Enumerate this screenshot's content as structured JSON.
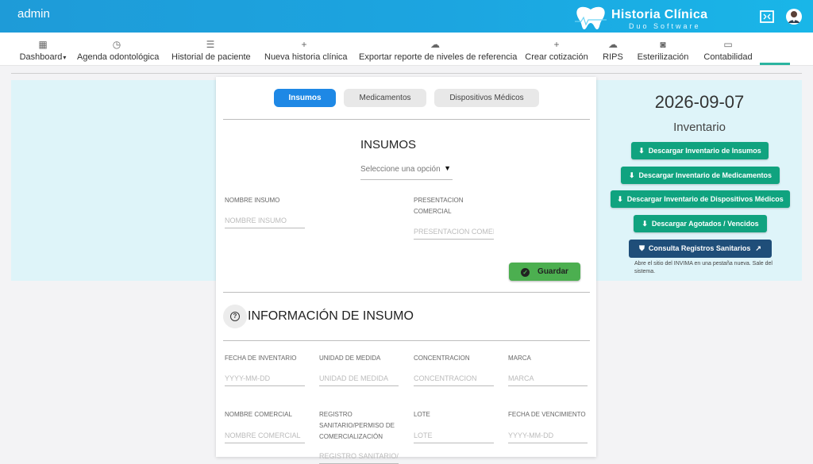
{
  "header": {
    "user": "admin",
    "logo_title": "Historia Clínica",
    "logo_subtitle": "Duo Software",
    "icons": [
      "expand-icon",
      "doctor-avatar-icon"
    ],
    "colors": {
      "bar_start": "#1e9bd8",
      "bar_end": "#19b6e8"
    }
  },
  "nav": {
    "items": [
      {
        "label": "Dashboard",
        "icon": "dashboard-icon",
        "glyph": "▦"
      },
      {
        "label": "Agenda odontológica",
        "icon": "clock-icon",
        "glyph": "◷"
      },
      {
        "label": "Historial de paciente",
        "icon": "list-icon",
        "glyph": "☰"
      },
      {
        "label": "Nueva historia clínica",
        "icon": "plus-icon",
        "glyph": "+"
      },
      {
        "label": "Exportar reporte de niveles de referencia",
        "icon": "cloud-download-icon",
        "glyph": "☁"
      },
      {
        "label": "Crear cotización",
        "icon": "plus-icon",
        "glyph": "+"
      },
      {
        "label": "RIPS",
        "icon": "cloud-download-icon",
        "glyph": "☁"
      },
      {
        "label": "Esterilización",
        "icon": "sterilizer-icon",
        "glyph": "◙"
      },
      {
        "label": "Contabilidad",
        "icon": "cash-icon",
        "glyph": "▭"
      }
    ],
    "dashboard_caret": "▾"
  },
  "tabs": [
    {
      "label": "Insumos",
      "active": true
    },
    {
      "label": "Medicamentos",
      "active": false
    },
    {
      "label": "Dispositivos Médicos",
      "active": false
    }
  ],
  "form": {
    "title": "INSUMOS",
    "select_placeholder": "Seleccione una opción",
    "select_arrow": "▼",
    "nombre_label": "NOMBRE INSUMO",
    "nombre_placeholder": "NOMBRE INSUMO",
    "presentacion_label": "PRESENTACION COMERCIAL",
    "presentacion_placeholder": "PRESENTACION COMERCIAL",
    "save_label": "Guardar"
  },
  "info": {
    "title": "INFORMACIÓN DE INSUMO",
    "fields": [
      {
        "label": "FECHA DE INVENTARIO",
        "placeholder": "YYYY-MM-DD"
      },
      {
        "label": "UNIDAD DE MEDIDA",
        "placeholder": "UNIDAD DE MEDIDA"
      },
      {
        "label": "CONCENTRACION",
        "placeholder": "CONCENTRACION"
      },
      {
        "label": "MARCA",
        "placeholder": "MARCA"
      },
      {
        "label": "NOMBRE COMERCIAL",
        "placeholder": "NOMBRE COMERCIAL"
      },
      {
        "label": "REGISTRO SANITARIO/PERMISO DE COMERCIALIZACIÓN",
        "placeholder": "REGISTRO SANITARIO/PERMISO DE COMERCIALIZACIÓN"
      },
      {
        "label": "LOTE",
        "placeholder": "LOTE"
      },
      {
        "label": "FECHA DE VENCIMIENTO",
        "placeholder": "YYYY-MM-DD"
      }
    ]
  },
  "sidebar": {
    "date": "2026-09-07",
    "subtitle": "Inventario",
    "buttons": [
      "Descargar Inventario de Insumos",
      "Descargar Inventario de Medicamentos",
      "Descargar Inventario de Dispositivos Médicos",
      "Descargar Agotados / Vencidos"
    ],
    "registry_button": "Consulta Registros Sanitarios",
    "registry_note": "Abre el sitio del INVIMA en una pestaña nueva. Sale del sistema.",
    "colors": {
      "green": "#10a37f",
      "navy": "#1f4e79"
    }
  }
}
